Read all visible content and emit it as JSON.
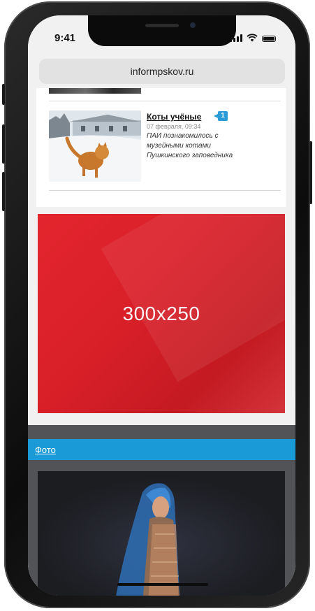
{
  "status_bar": {
    "time": "9:41"
  },
  "browser": {
    "url": "informpskov.ru"
  },
  "news_item": {
    "title": "Коты учёные",
    "comment_count": "1",
    "date": "07 февраля, 09:34",
    "description": "ПАИ познакомилось с музейными котами Пушкинского заповедника"
  },
  "ad": {
    "label": "300x250"
  },
  "photo_section": {
    "link": "Фото"
  },
  "colors": {
    "accent_blue": "#1a9ad6",
    "ad_red": "#d81f28",
    "section_gray": "#515356"
  }
}
